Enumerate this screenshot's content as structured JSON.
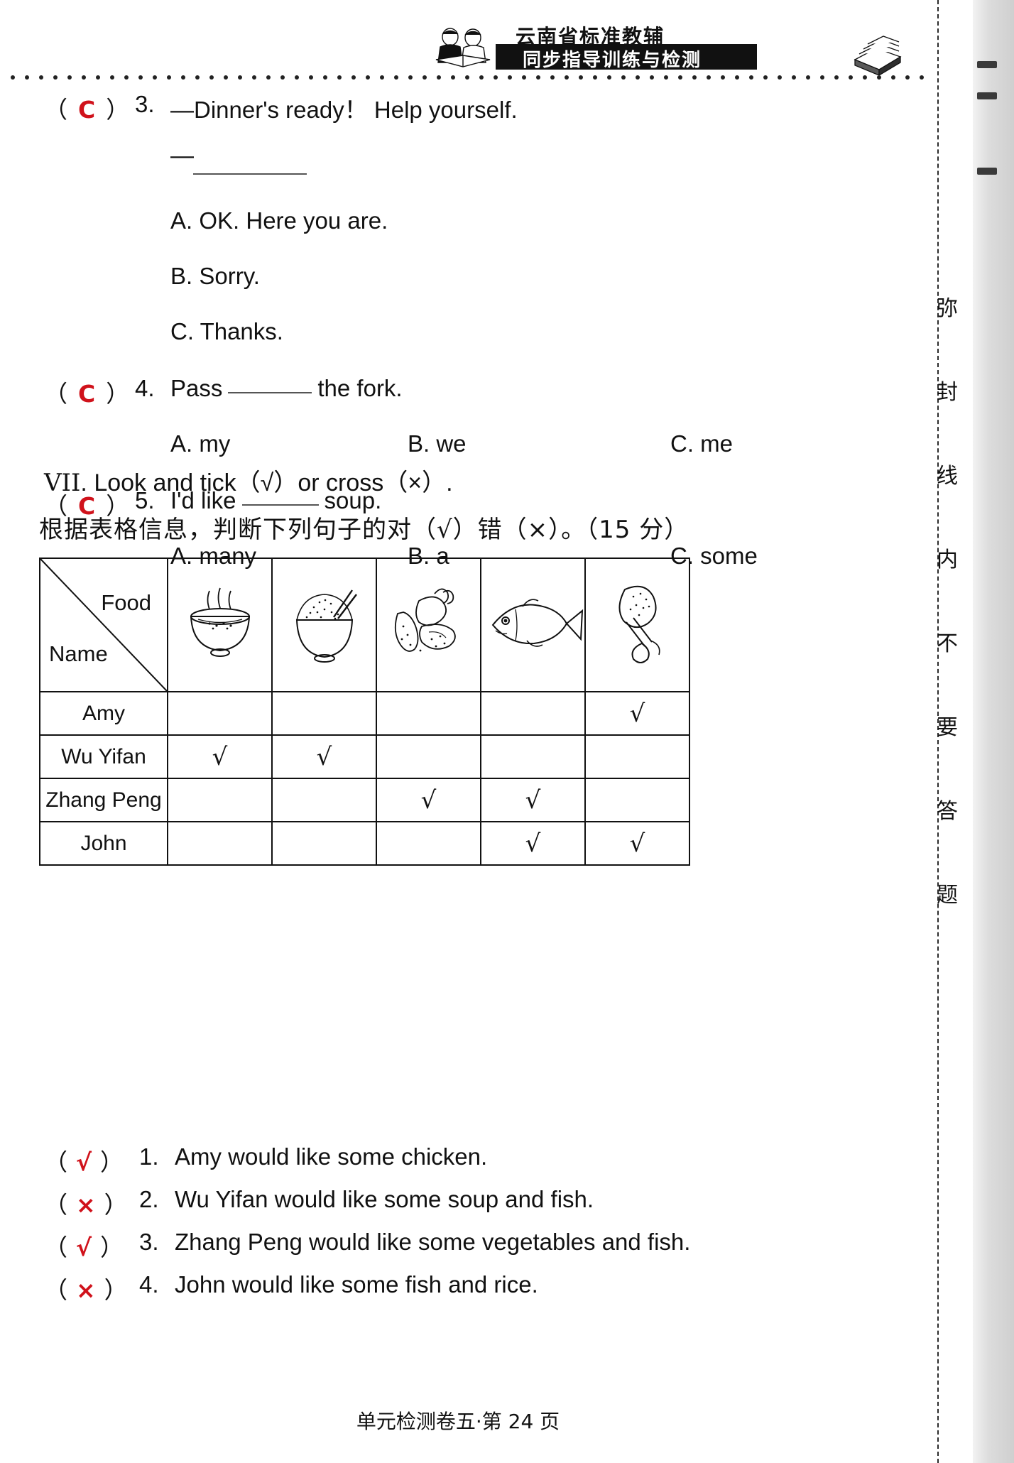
{
  "header": {
    "title_top": "云南省标准教辅",
    "title_bottom": "同步指导训练与检测"
  },
  "seal_margin": {
    "chars": [
      "弥",
      "封",
      "线",
      "内",
      "不",
      "要",
      "答",
      "题"
    ]
  },
  "mcq": {
    "questions": [
      {
        "answer": "C",
        "number": "3.",
        "stem_prefix": "—Dinner's ready！ Help yourself.",
        "stem_second": "—",
        "options": [
          "A.  OK.  Here you are.",
          "B.  Sorry.",
          "C.  Thanks."
        ]
      },
      {
        "answer": "C",
        "number": "4.",
        "stem_before": "Pass",
        "stem_after": "the fork.",
        "options": [
          "A.  my",
          "B.  we",
          "C.  me"
        ]
      },
      {
        "answer": "C",
        "number": "5.",
        "stem_before": "I'd like",
        "stem_after": "soup.",
        "options": [
          "A.  many",
          "B.  a",
          "C.  some"
        ]
      }
    ]
  },
  "section": {
    "roman": "VII",
    "heading": ".  Look and tick（√）or cross（×）.",
    "chinese_instruction": "根据表格信息，判断下列句子的对（√）错（×）。（15 分）"
  },
  "table": {
    "corner_food_label": "Food",
    "corner_name_label": "Name",
    "food_columns": [
      "soup-icon",
      "rice-icon",
      "vegetables-icon",
      "fish-icon",
      "chicken-icon"
    ],
    "rows": [
      {
        "name": "Amy",
        "marks": [
          "",
          "",
          "",
          "",
          "√"
        ]
      },
      {
        "name": "Wu Yifan",
        "marks": [
          "√",
          "√",
          "",
          "",
          ""
        ]
      },
      {
        "name": "Zhang Peng",
        "marks": [
          "",
          "",
          "√",
          "√",
          ""
        ]
      },
      {
        "name": "John",
        "marks": [
          "",
          "",
          "",
          "√",
          "√"
        ]
      }
    ]
  },
  "true_false": {
    "items": [
      {
        "mark": "√",
        "number": "1.",
        "text": "Amy would like some chicken."
      },
      {
        "mark": "×",
        "number": "2.",
        "text": "Wu Yifan would like some soup and fish."
      },
      {
        "mark": "√",
        "number": "3.",
        "text": "Zhang Peng would like some vegetables and fish."
      },
      {
        "mark": "×",
        "number": "4.",
        "text": "John would like some fish and rice."
      }
    ]
  },
  "footer": {
    "text": "单元检测卷五·第 24 页"
  },
  "colors": {
    "handwriting_red": "#d0121b",
    "ink_black": "#111111"
  }
}
